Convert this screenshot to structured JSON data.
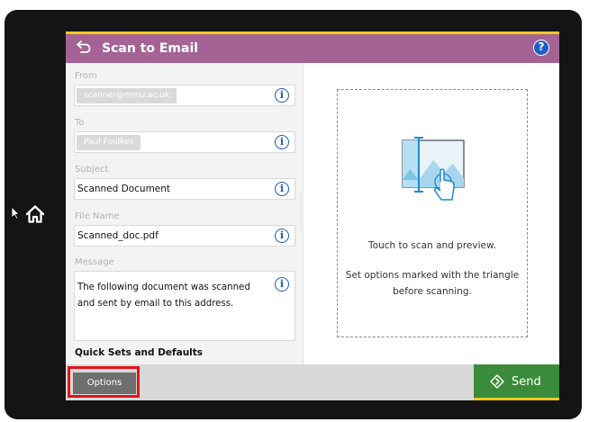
{
  "header": {
    "title": "Scan to Email",
    "help_label": "?"
  },
  "form": {
    "from": {
      "label": "From",
      "value": "scanner@mmu.ac.uk"
    },
    "to": {
      "label": "To",
      "value": "Paul Foulkes"
    },
    "subject": {
      "label": "Subject",
      "value": "Scanned Document"
    },
    "file_name": {
      "label": "File Name",
      "value": "Scanned_doc.pdf"
    },
    "message": {
      "label": "Message",
      "value": "The following document was scanned and sent by email to this address."
    },
    "info_glyph": "i",
    "quick_sets_label": "Quick Sets and Defaults"
  },
  "preview": {
    "touch_text": "Touch to scan and preview.",
    "options_hint": "Set options marked with the triangle before scanning."
  },
  "footer": {
    "options_label": "Options",
    "send_label": "Send"
  },
  "colors": {
    "titlebar": "#a46394",
    "accent_yellow": "#f2c81c",
    "send_green": "#3b8c3a",
    "highlight_red": "#e0131b",
    "info_blue": "#1c58b3",
    "help_blue": "#1d5fc7"
  }
}
